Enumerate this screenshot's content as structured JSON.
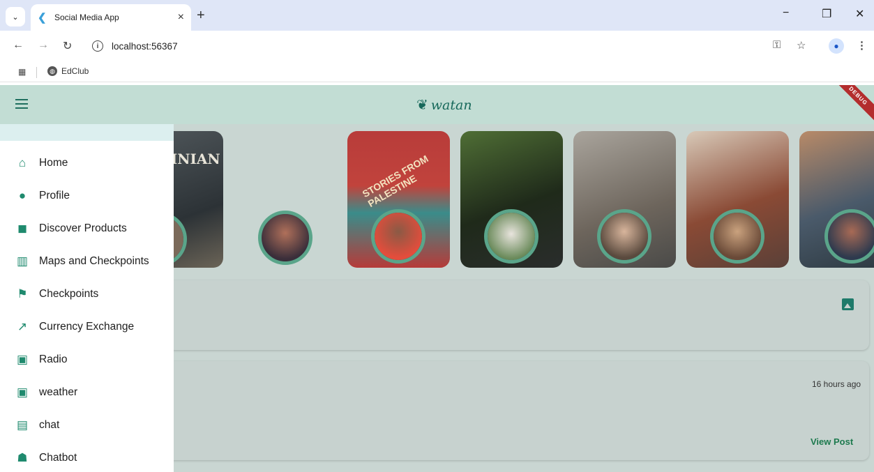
{
  "browser": {
    "tab_title": "Social Media App",
    "url": "localhost:56367",
    "bookmark": "EdClub"
  },
  "app": {
    "logo_text": "watan",
    "debug_banner": "DEBUG",
    "post_time": "16 hours ago",
    "view_post_label": "View Post"
  },
  "drawer": {
    "items": [
      {
        "label": "Home",
        "icon": "home-icon"
      },
      {
        "label": "Profile",
        "icon": "person-icon"
      },
      {
        "label": "Discover Products",
        "icon": "shopping-bag-icon"
      },
      {
        "label": "Maps and Checkpoints",
        "icon": "map-icon"
      },
      {
        "label": "Checkpoints",
        "icon": "flag-icon"
      },
      {
        "label": "Currency Exchange",
        "icon": "trending-up-icon"
      },
      {
        "label": "Radio",
        "icon": "radio-icon"
      },
      {
        "label": "weather",
        "icon": "radio-icon"
      },
      {
        "label": "chat",
        "icon": "chat-icon"
      },
      {
        "label": "Chatbot",
        "icon": "robot-icon"
      }
    ]
  },
  "colors": {
    "accent": "#1f8a6e",
    "appbar": "#c2ddd4",
    "view_post": "#1d7a4e"
  }
}
